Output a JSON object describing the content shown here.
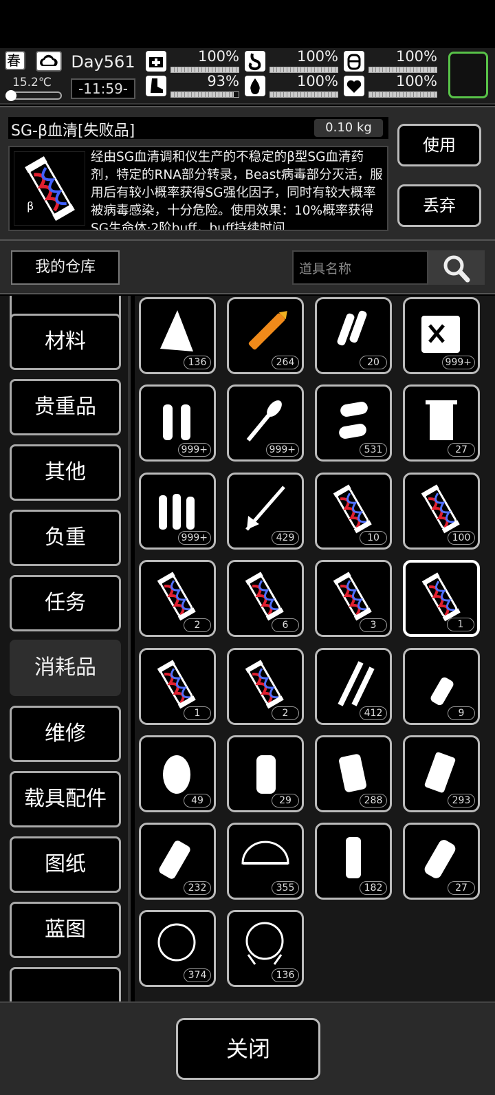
{
  "hud": {
    "season": "春",
    "temperature": "15.2℃",
    "day": "Day561",
    "clock": "-11:59-",
    "stats": [
      {
        "icon": "medkit-icon",
        "value": "100%",
        "fill": 1.0
      },
      {
        "icon": "stomach-icon",
        "value": "100%",
        "fill": 1.0
      },
      {
        "icon": "canteen-icon",
        "value": "100%",
        "fill": 1.0
      },
      {
        "icon": "boot-icon",
        "value": "93%",
        "fill": 0.93
      },
      {
        "icon": "water-drop-icon",
        "value": "100%",
        "fill": 1.0
      },
      {
        "icon": "heart-icon",
        "value": "100%",
        "fill": 1.0
      }
    ],
    "accent": "#58c248"
  },
  "detail": {
    "name": "SG-β血清[失败品]",
    "weight": "0.10 kg",
    "description": "经由SG血清调和仪生产的不稳定的β型SG血清药剂，特定的RNA部分转录，Beast病毒部分灭活，服用后有较小概率获得SG强化因子，同时有较大概率被病毒感染，十分危险。使用效果：10%概率获得SG生命体·2阶buff，buff持续时间",
    "use_label": "使用",
    "discard_label": "丢弃"
  },
  "warehouse": {
    "title": "我的仓库",
    "search_placeholder": "道具名称"
  },
  "sidebar": {
    "items": [
      {
        "label": "",
        "active": false
      },
      {
        "label": "材料",
        "active": false
      },
      {
        "label": "贵重品",
        "active": false
      },
      {
        "label": "其他",
        "active": false
      },
      {
        "label": "负重",
        "active": false
      },
      {
        "label": "任务",
        "active": false
      },
      {
        "label": "消耗品",
        "active": true
      },
      {
        "label": "维修",
        "active": false
      },
      {
        "label": "载具配件",
        "active": false
      },
      {
        "label": "图纸",
        "active": false
      },
      {
        "label": "蓝图",
        "active": false
      },
      {
        "label": "",
        "active": false
      }
    ]
  },
  "grid": {
    "items": [
      {
        "icon": "torn-cloth-icon",
        "count": "136"
      },
      {
        "icon": "syringe-rocket-icon",
        "count": "264"
      },
      {
        "icon": "shotgun-shells-icon",
        "count": "20"
      },
      {
        "icon": "fuel-can-icon",
        "count": "999+"
      },
      {
        "icon": "pistol-rounds-icon",
        "count": "999+"
      },
      {
        "icon": "rpg-rocket-icon",
        "count": "999+"
      },
      {
        "icon": "large-shells-icon",
        "count": "531"
      },
      {
        "icon": "towel-icon",
        "count": "27"
      },
      {
        "icon": "rifle-rounds-icon",
        "count": "999+"
      },
      {
        "icon": "arrow-icon",
        "count": "429"
      },
      {
        "icon": "serum-alpha-ii-icon",
        "count": "10"
      },
      {
        "icon": "grenade-round-icon",
        "count": "100"
      },
      {
        "icon": "serum-alpha-failed-icon",
        "count": "2"
      },
      {
        "icon": "serum-alpha-broken-icon",
        "count": "6"
      },
      {
        "icon": "serum-alpha-i-icon",
        "count": "3"
      },
      {
        "icon": "serum-beta-failed-icon",
        "count": "1"
      },
      {
        "icon": "serum-alpha-viii-icon",
        "count": "1"
      },
      {
        "icon": "serum-alpha-v-icon",
        "count": "2"
      },
      {
        "icon": "sniper-rounds-icon",
        "count": "412"
      },
      {
        "icon": "molotov-icon",
        "count": "9"
      },
      {
        "icon": "frag-grenade-icon",
        "count": "49"
      },
      {
        "icon": "gas-grenade-icon",
        "count": "29"
      },
      {
        "icon": "incendiary-grenade-icon",
        "count": "288"
      },
      {
        "icon": "smoke-grenade-icon",
        "count": "293"
      },
      {
        "icon": "flashbang-icon",
        "count": "232"
      },
      {
        "icon": "net-trap-icon",
        "count": "355"
      },
      {
        "icon": "stun-grenade-icon",
        "count": "182"
      },
      {
        "icon": "toxic-canister-icon",
        "count": "27"
      },
      {
        "icon": "net-ball-icon",
        "count": "374"
      },
      {
        "icon": "net-launcher-icon",
        "count": "136"
      }
    ],
    "selected_index": 15
  },
  "footer": {
    "close_label": "关闭"
  }
}
